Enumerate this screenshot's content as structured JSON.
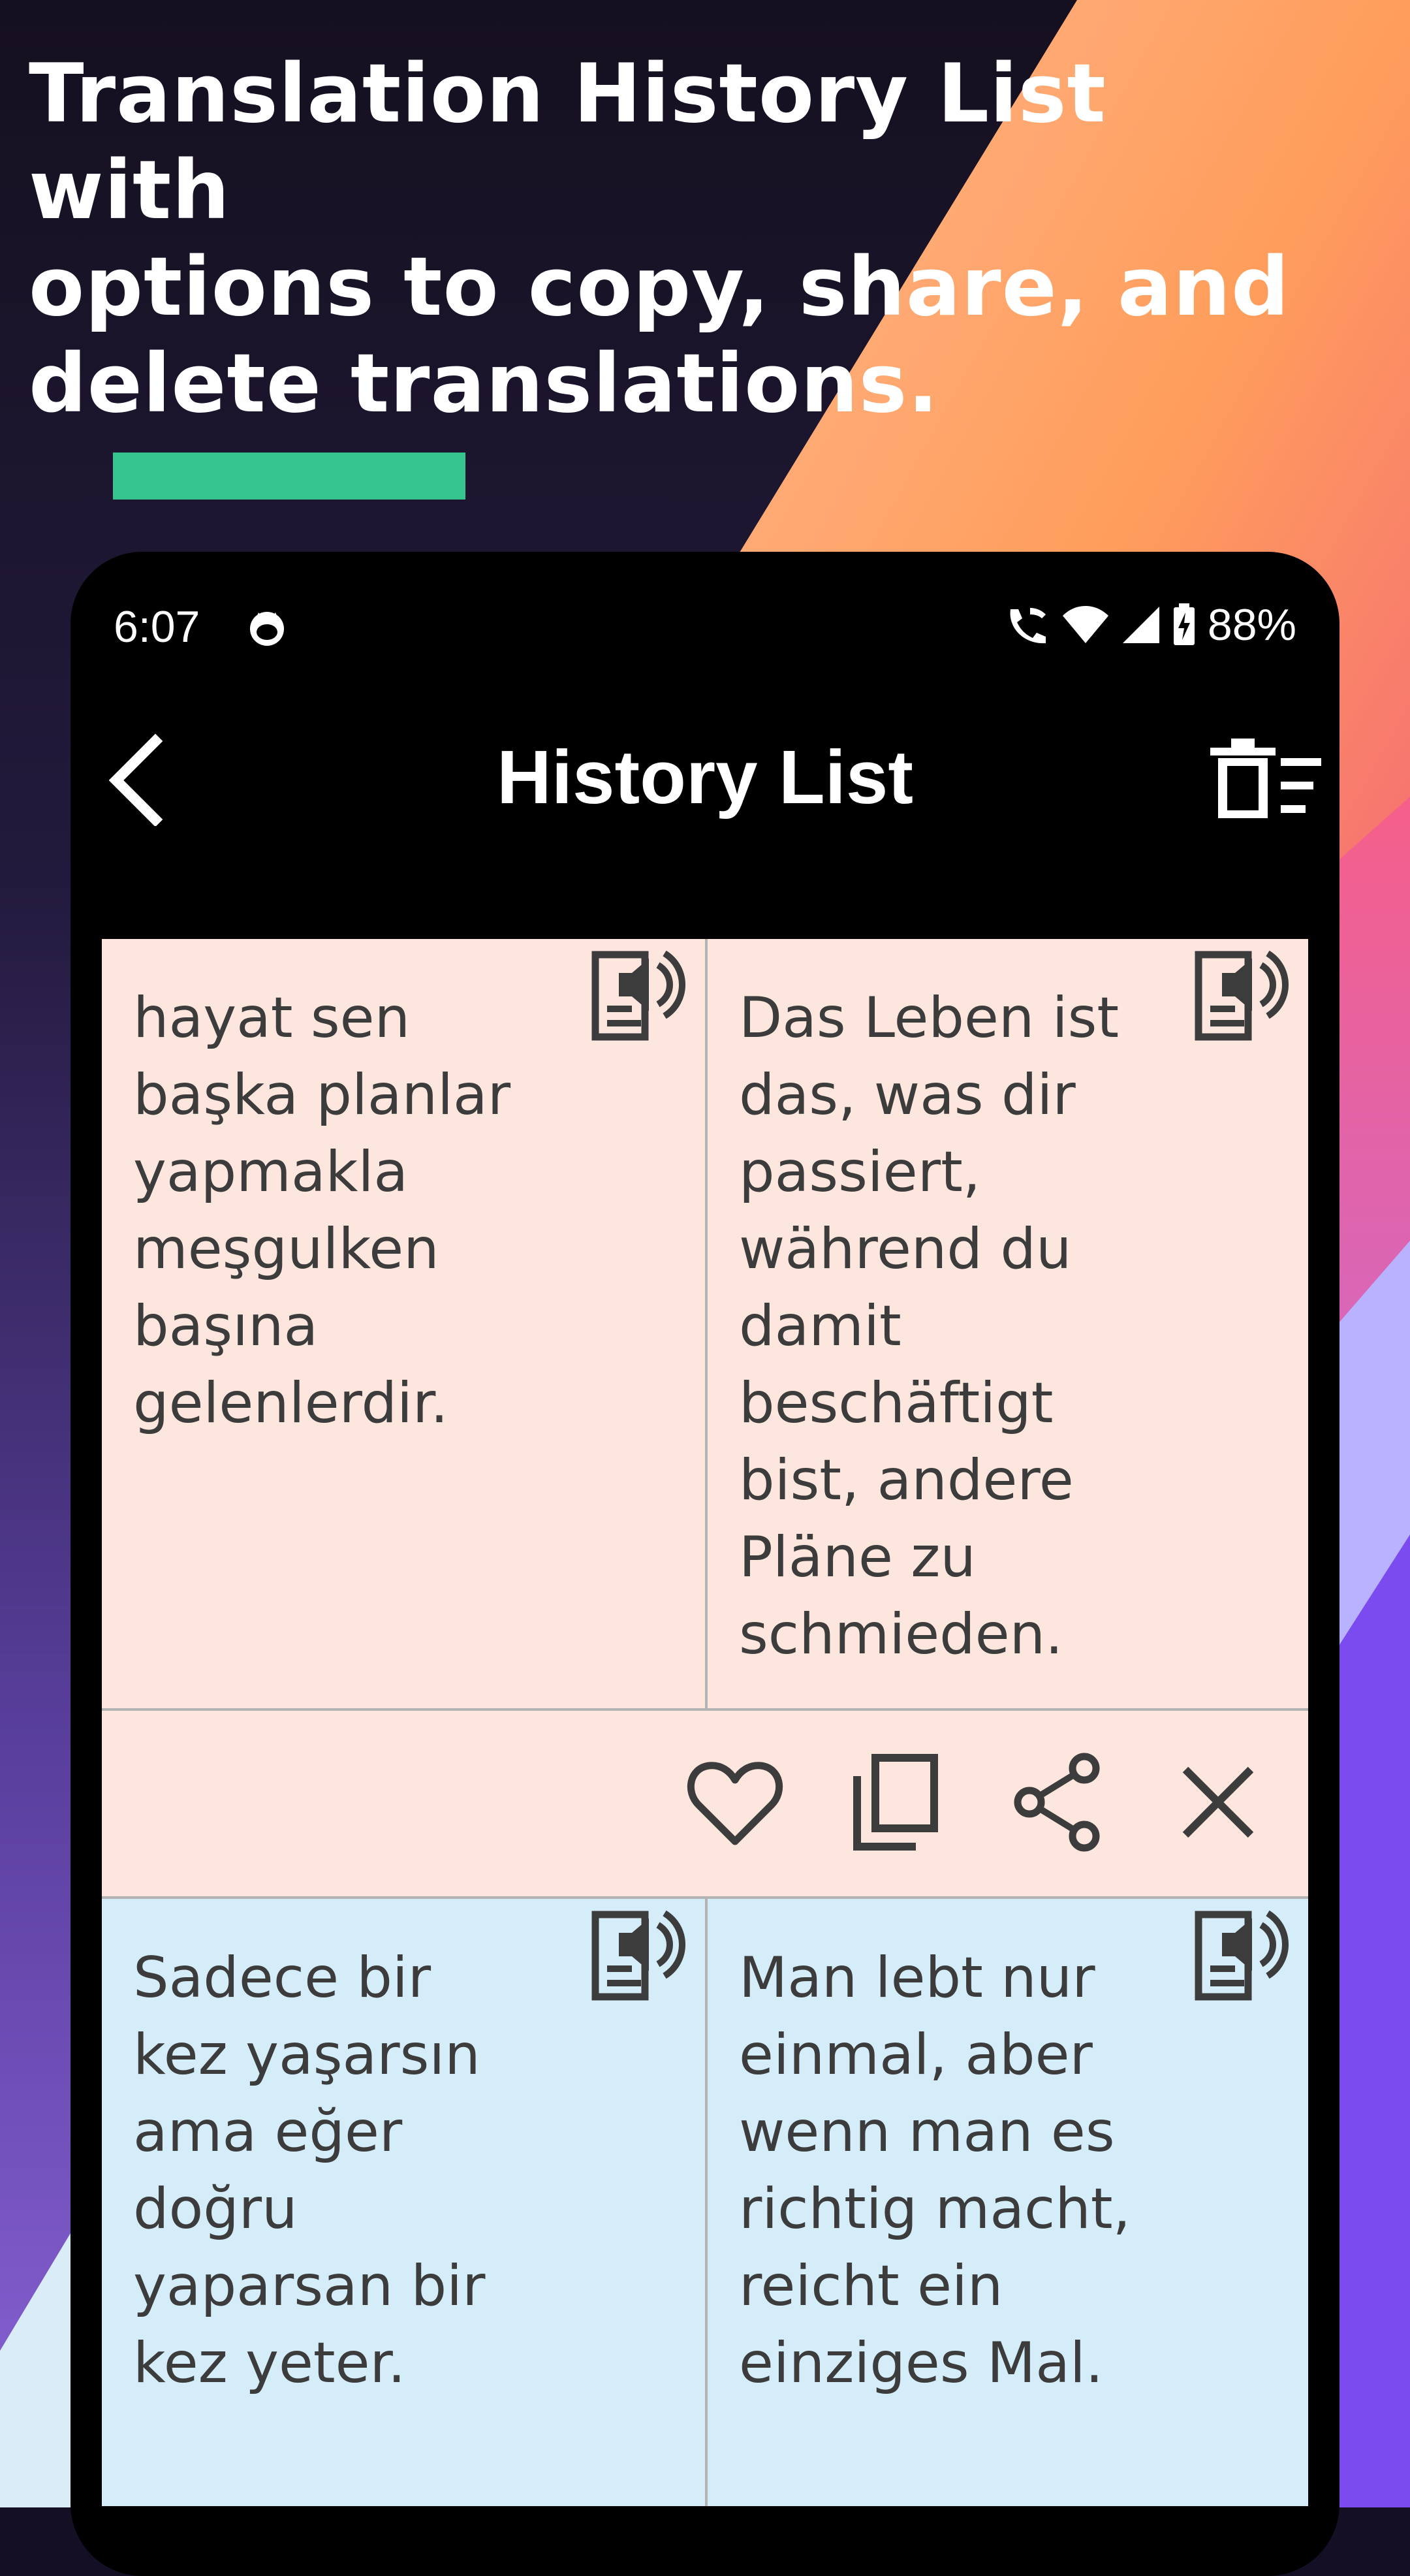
{
  "headline": {
    "lines": [
      "Translation History List with",
      "options to copy, share, and",
      "delete translations."
    ]
  },
  "colors": {
    "accent_bar": "#36c58f",
    "card_source_bg": "#fde6dd",
    "card_second_bg": "#d5ecf9",
    "phone_bg": "#000000"
  },
  "status_bar": {
    "time": "6:07",
    "battery": "88%",
    "icons": [
      "cat-notification-icon",
      "wifi-call-icon",
      "wifi-icon",
      "signal-icon",
      "battery-charging-icon"
    ]
  },
  "toolbar": {
    "title": "History List",
    "back_icon": "chevron-left-icon",
    "clear_icon": "delete-all-icon"
  },
  "history": [
    {
      "source": "hayat sen başka planlar yapmakla meşgulken başına gelenlerdir.",
      "target": "Das Leben ist das, was dir passiert, während du damit beschäftigt bist, andere Pläne zu schmieden.",
      "actions": [
        "favorite-icon",
        "copy-icon",
        "share-icon",
        "delete-icon"
      ]
    },
    {
      "source": "Sadece bir kez yaşarsın ama eğer doğru yaparsan bir kez yeter.",
      "target": "Man lebt nur einmal, aber wenn man es richtig macht, reicht ein einziges Mal."
    }
  ]
}
